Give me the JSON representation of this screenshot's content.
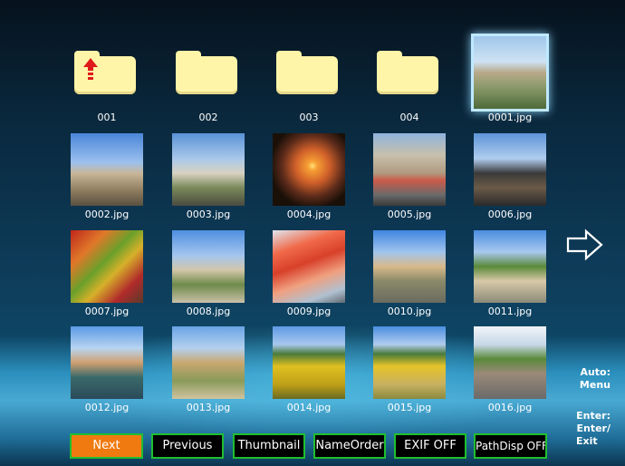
{
  "folders": [
    {
      "label": "001",
      "up": true
    },
    {
      "label": "002",
      "up": false
    },
    {
      "label": "003",
      "up": false
    },
    {
      "label": "004",
      "up": false
    }
  ],
  "photos": [
    {
      "label": "0001.jpg",
      "selected": true
    },
    {
      "label": "0002.jpg"
    },
    {
      "label": "0003.jpg"
    },
    {
      "label": "0004.jpg"
    },
    {
      "label": "0005.jpg"
    },
    {
      "label": "0006.jpg"
    },
    {
      "label": "0007.jpg"
    },
    {
      "label": "0008.jpg"
    },
    {
      "label": "0009.jpg"
    },
    {
      "label": "0010.jpg"
    },
    {
      "label": "0011.jpg"
    },
    {
      "label": "0012.jpg"
    },
    {
      "label": "0013.jpg"
    },
    {
      "label": "0014.jpg"
    },
    {
      "label": "0015.jpg"
    },
    {
      "label": "0016.jpg"
    }
  ],
  "side_help": {
    "auto_line1": "Auto:",
    "auto_line2": "Menu",
    "enter_line1": "Enter:",
    "enter_line2": "Enter/",
    "enter_line3": "Exit"
  },
  "buttons": {
    "next": "Next",
    "previous": "Previous",
    "thumbnail": "Thumbnail",
    "name_order": "NameOrder",
    "exif": "EXIF OFF",
    "path_disp": "PathDisp OFF"
  },
  "colors": {
    "active_button": "#f07a10",
    "button_border": "#1fbf2f",
    "folder": "#fff5a8",
    "selection_glow": "#bfe9ff"
  },
  "icons": {
    "next_page": "right-arrow-icon",
    "parent_folder": "up-arrow-icon"
  }
}
